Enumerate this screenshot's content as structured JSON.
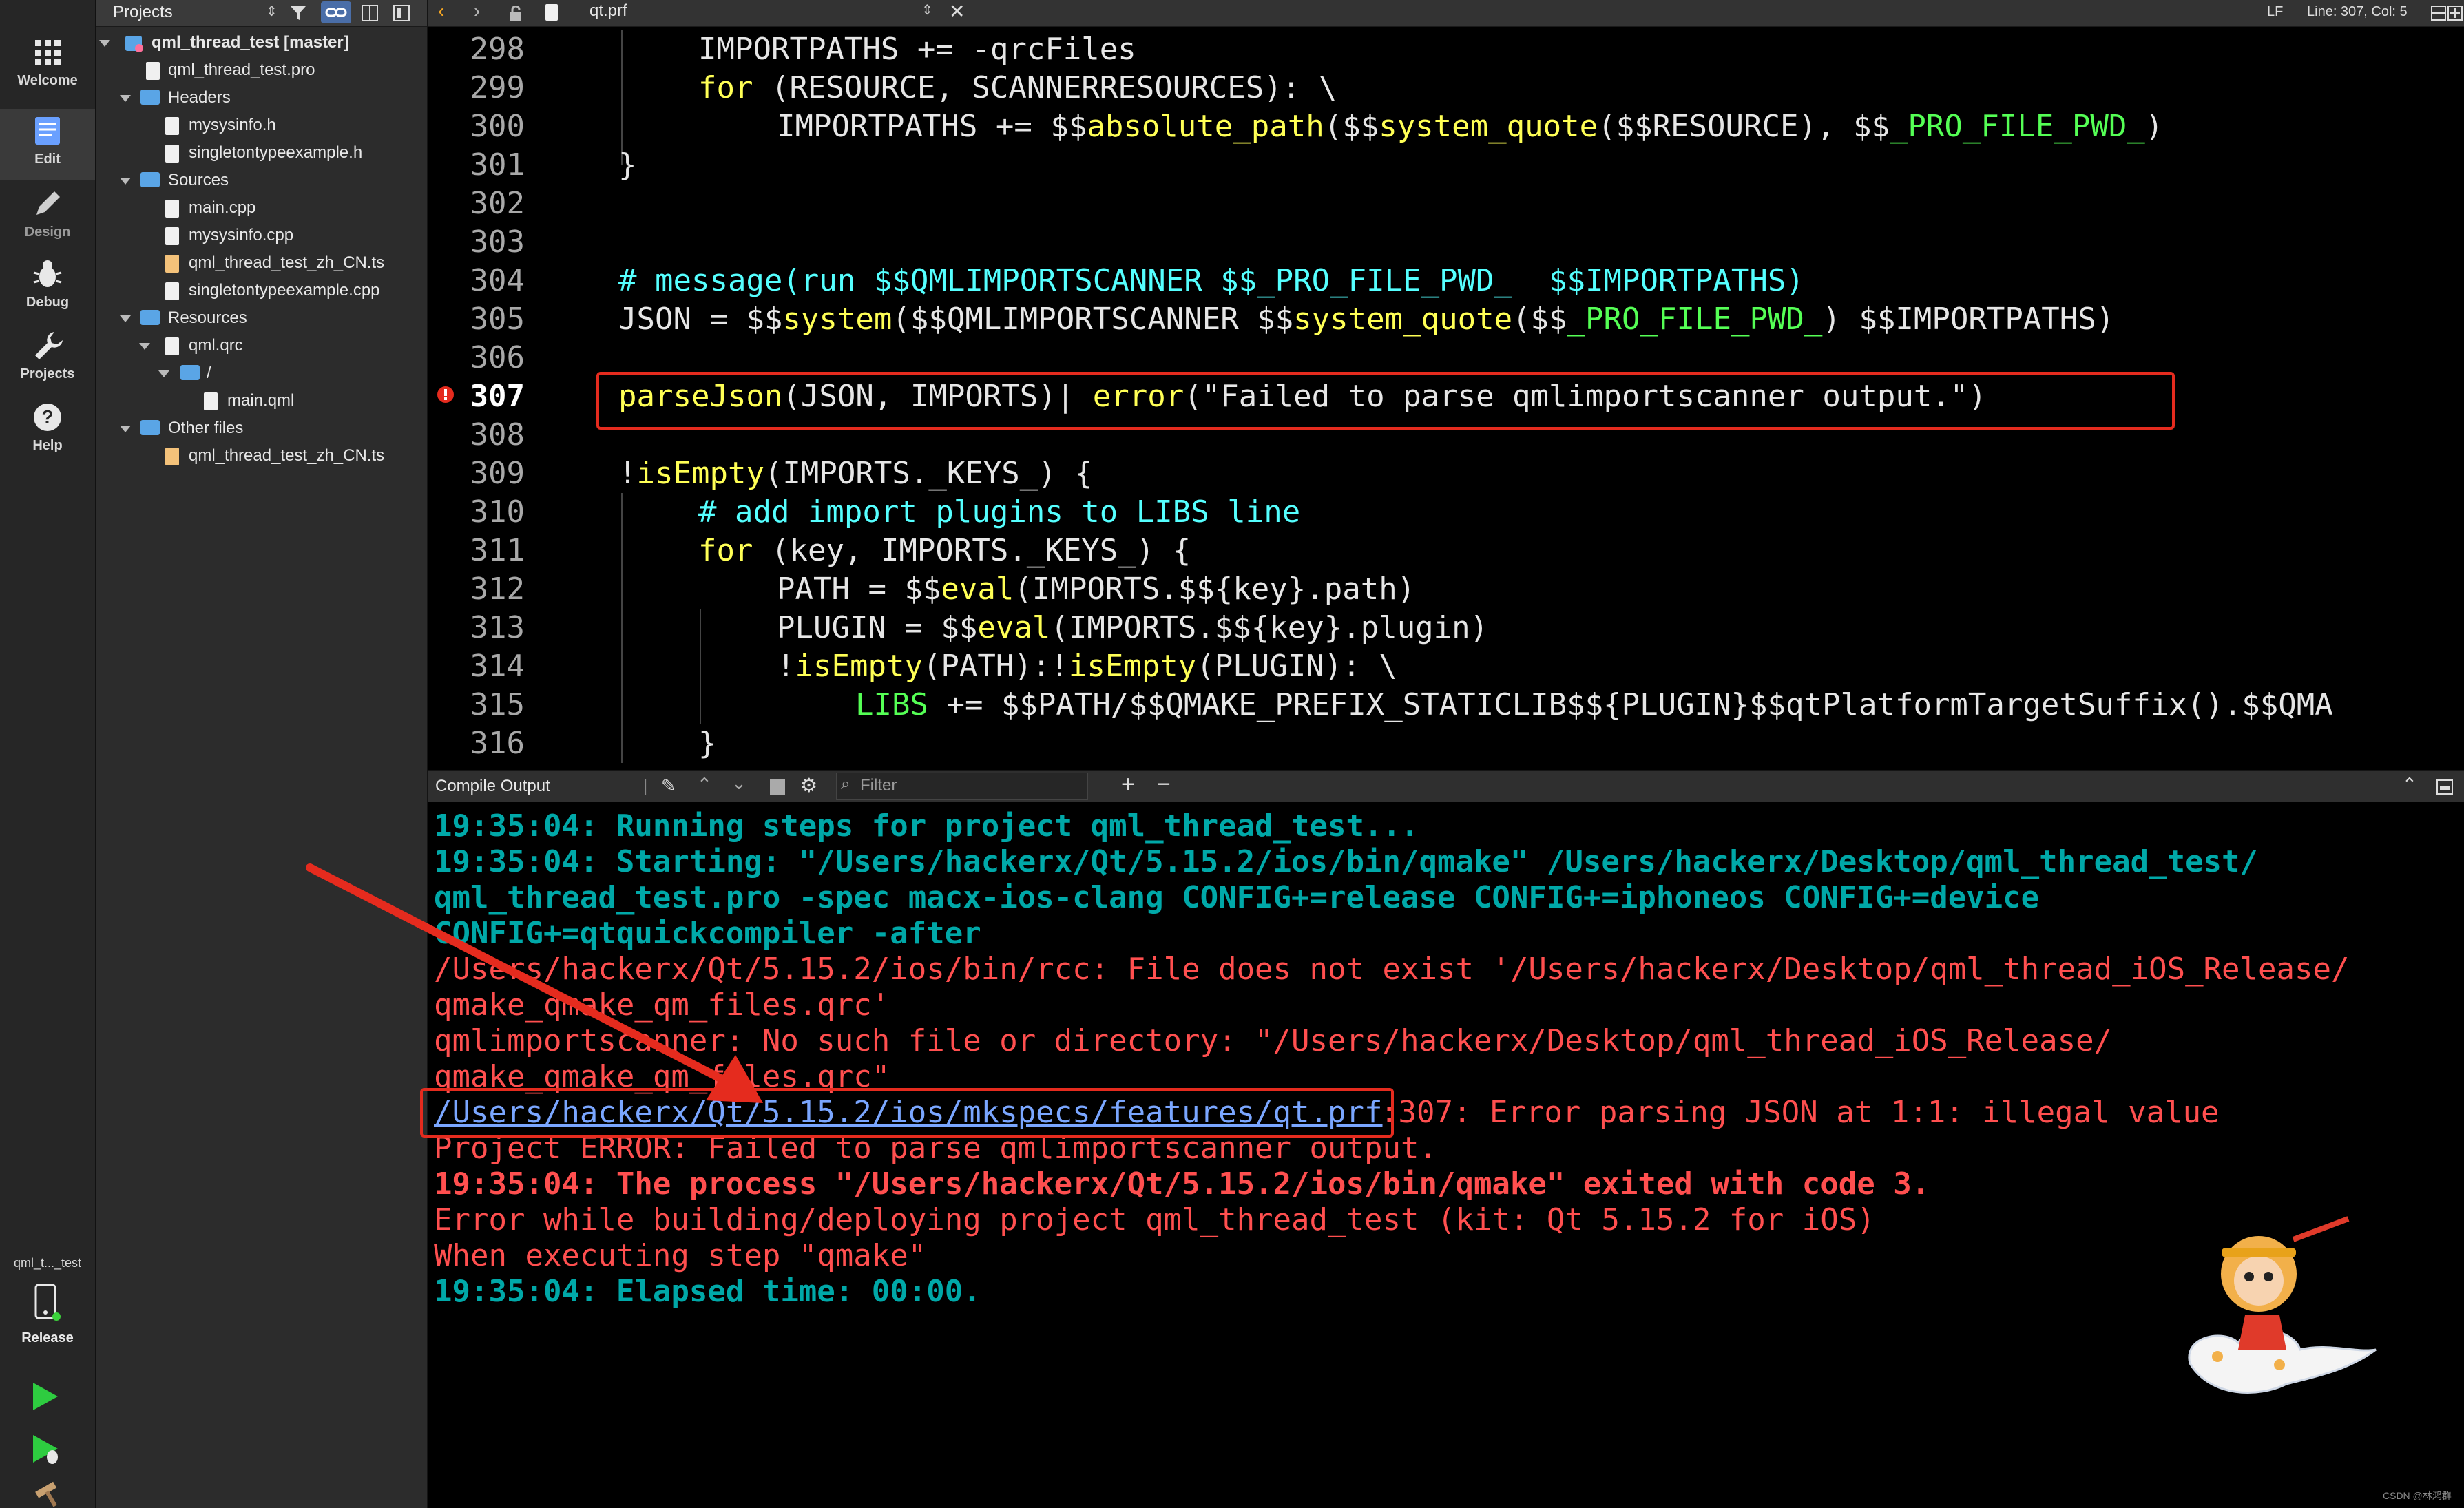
{
  "modes": [
    {
      "label": "Welcome",
      "icon": "grid-icon",
      "active": false
    },
    {
      "label": "Edit",
      "icon": "edit-icon",
      "active": true
    },
    {
      "label": "Design",
      "icon": "pencil-icon",
      "active": false
    },
    {
      "label": "Debug",
      "icon": "bug-icon",
      "active": false
    },
    {
      "label": "Projects",
      "icon": "wrench-icon",
      "active": false
    },
    {
      "label": "Help",
      "icon": "help-icon",
      "active": false
    }
  ],
  "kit": {
    "project": "qml_t..._test",
    "config": "Release"
  },
  "tree": {
    "title": "Projects",
    "rows": [
      {
        "label": "qml_thread_test [master]"
      },
      {
        "label": "qml_thread_test.pro"
      },
      {
        "label": "Headers"
      },
      {
        "label": "mysysinfo.h"
      },
      {
        "label": "singletontypeexample.h"
      },
      {
        "label": "Sources"
      },
      {
        "label": "main.cpp"
      },
      {
        "label": "mysysinfo.cpp"
      },
      {
        "label": "qml_thread_test_zh_CN.ts"
      },
      {
        "label": "singletontypeexample.cpp"
      },
      {
        "label": "Resources"
      },
      {
        "label": "qml.qrc"
      },
      {
        "label": "/"
      },
      {
        "label": "main.qml"
      },
      {
        "label": "Other files"
      },
      {
        "label": "qml_thread_test_zh_CN.ts"
      }
    ]
  },
  "editor": {
    "filename": "qt.prf",
    "line_ending": "LF",
    "cursor": "Line: 307, Col: 5",
    "line_numbers": [
      "298",
      "299",
      "300",
      "301",
      "302",
      "303",
      "304",
      "305",
      "306",
      "307",
      "308",
      "309",
      "310",
      "311",
      "312",
      "313",
      "314",
      "315",
      "316"
    ]
  },
  "output": {
    "title": "Compile Output",
    "filter_placeholder": "Filter",
    "lines": [
      "19:35:04: Running steps for project qml_thread_test...",
      "19:35:04: Starting: \"/Users/hackerx/Qt/5.15.2/ios/bin/qmake\" /Users/hackerx/Desktop/qml_thread_test/",
      "qml_thread_test.pro -spec macx-ios-clang CONFIG+=release CONFIG+=iphoneos CONFIG+=device",
      "CONFIG+=qtquickcompiler -after",
      "/Users/hackerx/Qt/5.15.2/ios/bin/rcc: File does not exist '/Users/hackerx/Desktop/qml_thread_iOS_Release/",
      "qmake_qmake_qm_files.qrc'",
      "qmlimportscanner: No such file or directory: \"/Users/hackerx/Desktop/qml_thread_iOS_Release/",
      "qmake_qmake_qm_files.qrc\"",
      "/Users/hackerx/Qt/5.15.2/ios/mkspecs/features/qt.prf",
      ":307: Error parsing JSON at 1:1: illegal value",
      "Project ERROR: Failed to parse qmlimportscanner output.",
      "19:35:04: The process \"/Users/hackerx/Qt/5.15.2/ios/bin/qmake\" exited with code 3.",
      "Error while building/deploying project qml_thread_test (kit: Qt 5.15.2 for iOS)",
      "When executing step \"qmake\"",
      "19:35:04: Elapsed time: 00:00."
    ]
  },
  "watermark": "CSDN @林鸿群",
  "colors": {
    "annotation": "#e52b1e",
    "keyword": "#ffff55",
    "comment": "#55ffff",
    "green": "#55ff55",
    "teal": "#00a8a8",
    "error": "#ff4f4f"
  }
}
